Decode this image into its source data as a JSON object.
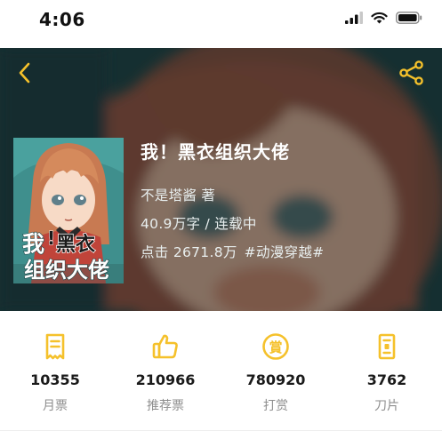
{
  "status_bar": {
    "time": "4:06"
  },
  "header": {
    "back_icon": "chevron-left-icon",
    "share_icon": "share-icon",
    "accent_color": "#f5c12b"
  },
  "book": {
    "title": "我！黑衣组织大佬",
    "author": "不是塔酱  著",
    "word_count_status": "40.9万字 / 连载中",
    "clicks": "点击 2671.8万",
    "tag": "#动漫穿越#",
    "cover_title": "我！黑衣组织大佬"
  },
  "stats": [
    {
      "icon": "ticket-icon",
      "value": "10355",
      "label": "月票"
    },
    {
      "icon": "thumbs-up-icon",
      "value": "210966",
      "label": "推荐票"
    },
    {
      "icon": "reward-coin-icon",
      "value": "780920",
      "label": "打赏"
    },
    {
      "icon": "blade-icon",
      "value": "3762",
      "label": "刀片"
    }
  ]
}
